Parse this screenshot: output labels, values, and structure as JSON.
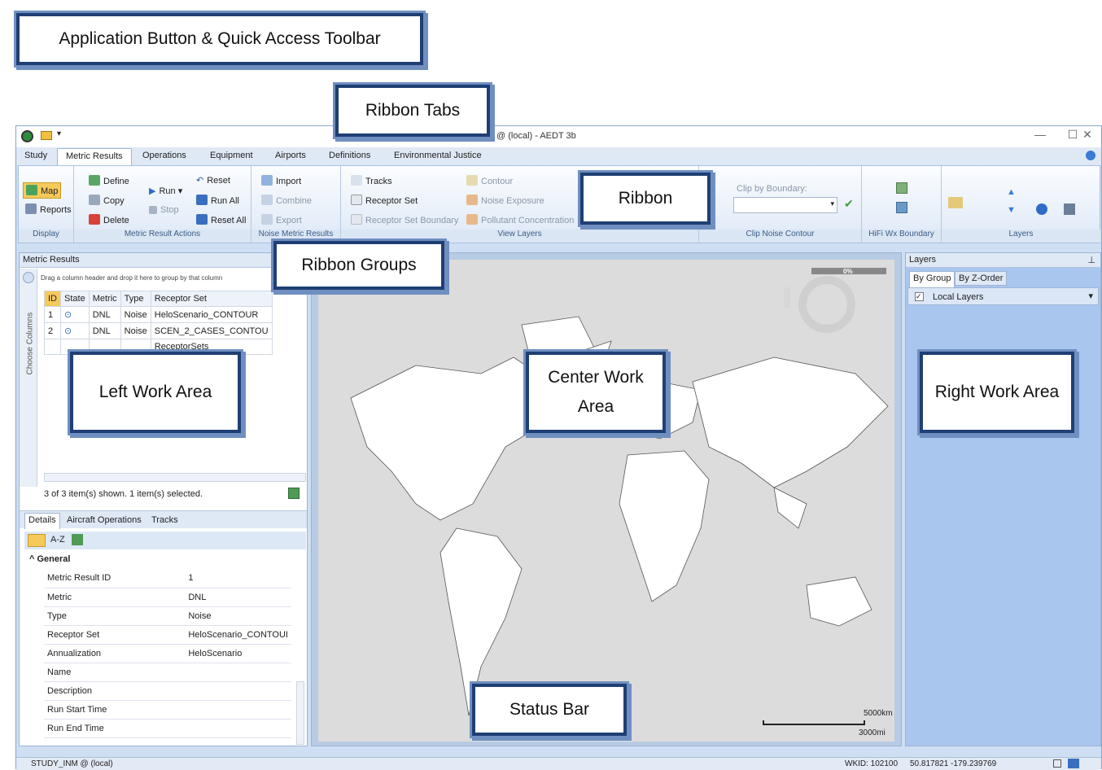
{
  "annotations": {
    "app_button": "Application Button & Quick Access Toolbar",
    "ribbon_tabs": "Ribbon Tabs",
    "ribbon": "Ribbon",
    "ribbon_groups": "Ribbon Groups",
    "left_work_area": "Left Work Area",
    "center_work_area": "Center Work Area",
    "right_work_area": "Right Work Area",
    "status_bar": "Status Bar"
  },
  "window": {
    "title": "@ (local) - AEDT 3b",
    "min": "—",
    "max": "☐",
    "close": "✕"
  },
  "tabs": [
    "Study",
    "Metric Results",
    "Operations",
    "Equipment",
    "Airports",
    "Definitions",
    "Environmental Justice"
  ],
  "ribbon": {
    "display": {
      "map": "Map",
      "reports": "Reports",
      "label": "Display"
    },
    "metric_actions": {
      "define": "Define",
      "copy": "Copy",
      "delete": "Delete",
      "run": "Run",
      "stop": "Stop",
      "reset": "Reset",
      "run_all": "Run All",
      "reset_all": "Reset All",
      "label": "Metric Result Actions"
    },
    "noise": {
      "import": "Import",
      "combine": "Combine",
      "export": "Export",
      "label": "Noise Metric Results"
    },
    "view_layers": {
      "tracks": "Tracks",
      "receptor_set": "Receptor Set",
      "receptor_boundary": "Receptor Set Boundary",
      "contour": "Contour",
      "noise_exposure": "Noise Exposure",
      "pollutant": "Pollutant Concentration",
      "label": "View Layers"
    },
    "clip": {
      "field_label": "Clip by Boundary:",
      "label": "Clip Noise Contour"
    },
    "hifi": {
      "label": "HiFi Wx Boundary"
    },
    "layers": {
      "label": "Layers"
    }
  },
  "left": {
    "title": "Metric Results",
    "drag_hint": "Drag a column header and drop it here to group by that column",
    "choose_columns": "Choose Columns",
    "columns": [
      "ID",
      "State",
      "Metric",
      "Type",
      "Receptor Set"
    ],
    "rows": [
      {
        "id": "1",
        "metric": "DNL",
        "type": "Noise",
        "receptor": "HeloScenario_CONTOUR"
      },
      {
        "id": "2",
        "metric": "DNL",
        "type": "Noise",
        "receptor": "SCEN_2_CASES_CONTOU"
      },
      {
        "id": "",
        "metric": "",
        "type": "",
        "receptor": "ReceptorSets"
      }
    ],
    "count": "3 of 3 item(s) shown. 1 item(s) selected.",
    "detail_tabs": [
      "Details",
      "Aircraft Operations",
      "Tracks"
    ],
    "sort_az": "A-Z",
    "section": "General",
    "props": [
      [
        "Metric Result ID",
        "1"
      ],
      [
        "Metric",
        "DNL"
      ],
      [
        "Type",
        "Noise"
      ],
      [
        "Receptor Set",
        "HeloScenario_CONTOUI"
      ],
      [
        "Annualization",
        "HeloScenario"
      ],
      [
        "Name",
        ""
      ],
      [
        "Description",
        ""
      ],
      [
        "Run Start Time",
        ""
      ],
      [
        "Run End Time",
        ""
      ]
    ]
  },
  "map": {
    "progress": "0%",
    "scale_km": "5000km",
    "scale_mi": "3000mi"
  },
  "right": {
    "title": "Layers",
    "tab_group": "By Group",
    "tab_z": "By Z-Order",
    "local_layers": "Local Layers"
  },
  "status": {
    "study": "STUDY_INM @ (local)",
    "wkid": "WKID: 102100",
    "coords": "50.817821 -179.239769"
  }
}
